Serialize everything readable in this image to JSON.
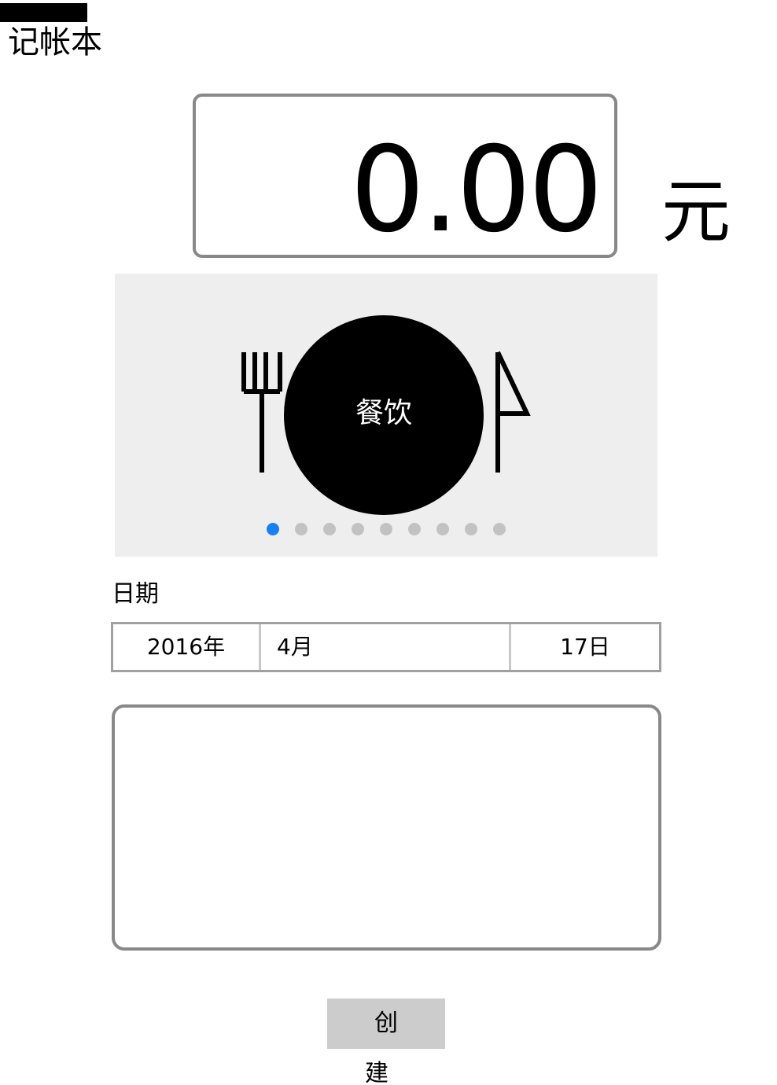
{
  "app": {
    "title": "记帐本"
  },
  "amount": {
    "value": "0.00",
    "currency": "元"
  },
  "category_carousel": {
    "current_label": "餐饮",
    "icon": "plate-fork-knife-icon",
    "page_count": 9,
    "active_index": 0
  },
  "date": {
    "label": "日期",
    "year": "2016年",
    "month": "4月",
    "day": "17日"
  },
  "note": {
    "value": ""
  },
  "actions": {
    "create_label": "创 建"
  },
  "colors": {
    "active_dot": "#1a7ff0",
    "inactive_dot": "#c2c2c2",
    "carousel_bg": "#eeeeee",
    "button_bg": "#cccccc"
  }
}
